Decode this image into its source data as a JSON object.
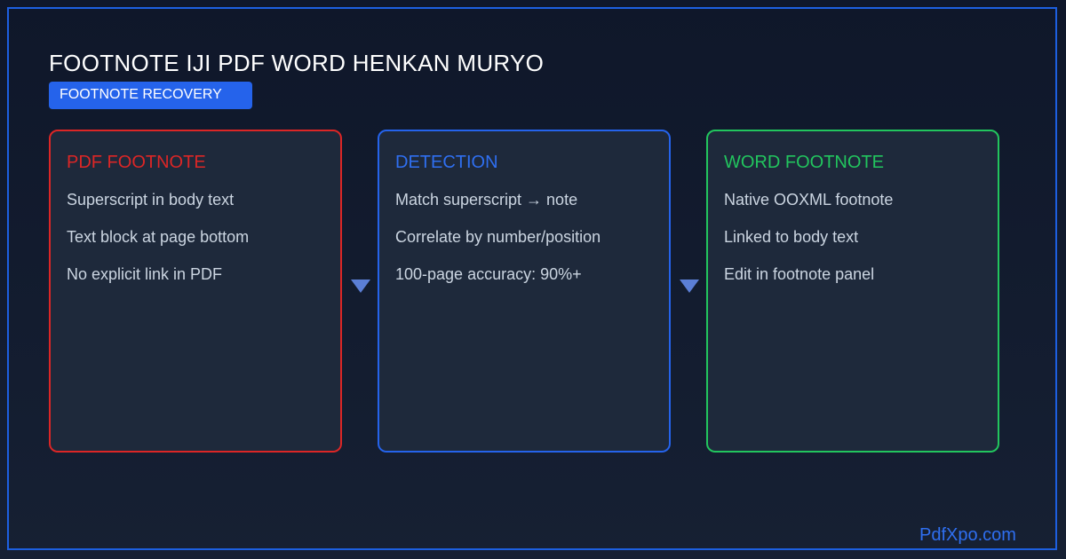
{
  "header": {
    "title": "FOOTNOTE IJI PDF WORD HENKAN MURYO",
    "badge": "FOOTNOTE RECOVERY"
  },
  "cards": [
    {
      "title": "PDF FOOTNOTE",
      "items": [
        "Superscript in body text",
        "Text block at page bottom",
        "No explicit link in PDF"
      ]
    },
    {
      "title": "DETECTION",
      "items": [
        "Match superscript → note",
        "Correlate by number/position",
        "100-page accuracy: 90%+"
      ]
    },
    {
      "title": "WORD FOOTNOTE",
      "items": [
        "Native OOXML footnote",
        "Linked to body text",
        "Edit in footnote panel"
      ]
    }
  ],
  "footer": {
    "brand": "PdfXpo.com"
  },
  "colors": {
    "background": "#0f172a",
    "frame": "#1d5fe0",
    "pdf_accent": "#dc2626",
    "detection_accent": "#2563eb",
    "word_accent": "#22c55e",
    "arrow": "#5b7fd6"
  }
}
